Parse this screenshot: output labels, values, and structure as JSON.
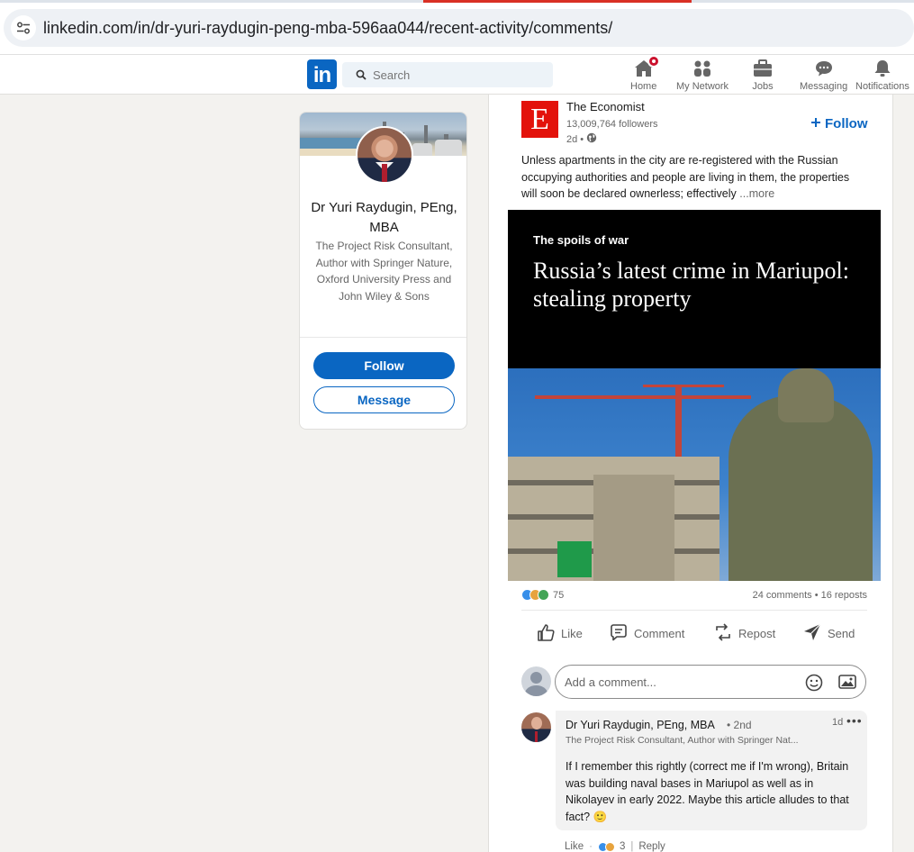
{
  "browser": {
    "url": "linkedin.com/in/dr-yuri-raydugin-peng-mba-596aa044/recent-activity/comments/"
  },
  "nav": {
    "logo": "in",
    "search_placeholder": "Search",
    "items": [
      {
        "label": "Home",
        "icon": "home-icon"
      },
      {
        "label": "My Network",
        "icon": "network-icon"
      },
      {
        "label": "Jobs",
        "icon": "briefcase-icon"
      },
      {
        "label": "Messaging",
        "icon": "messaging-icon"
      },
      {
        "label": "Notifications",
        "icon": "bell-icon"
      }
    ],
    "accent": "#0a66c2"
  },
  "profile": {
    "name": "Dr Yuri Raydugin, PEng, MBA",
    "headline": "The Project Risk Consultant, Author with Springer Nature, Oxford University Press and John Wiley & Sons",
    "follow_label": "Follow",
    "message_label": "Message"
  },
  "post": {
    "author": "The Economist",
    "logo_letter": "E",
    "followers": "13,009,764 followers",
    "age": "2d",
    "follow_label": "Follow",
    "text": "Unless apartments in the city are re-registered with the Russian occupying authorities and people are living in them, the properties will soon be declared ownerless; effectively",
    "more_label": "...more",
    "article": {
      "kicker": "The spoils of war",
      "title": "Russia’s latest crime in Mariupol: stealing property"
    },
    "reaction_count": "75",
    "engagement": "24 comments • 16 reposts",
    "actions": {
      "like": "Like",
      "comment": "Comment",
      "repost": "Repost",
      "send": "Send"
    },
    "comment_placeholder": "Add a comment..."
  },
  "comment": {
    "author": "Dr Yuri Raydugin, PEng, MBA",
    "degree": "• 2nd",
    "time": "1d",
    "menu": "•••",
    "headline": "The Project Risk Consultant, Author with Springer Nat...",
    "body": "If I remember this rightly (correct me if I'm wrong), Britain was building naval bases in Mariupol as well as in Nikolayev in early 2022. Maybe this article alludes to that fact? 🙂",
    "like_label": "Like",
    "reaction_count": "3",
    "reply_label": "Reply"
  }
}
